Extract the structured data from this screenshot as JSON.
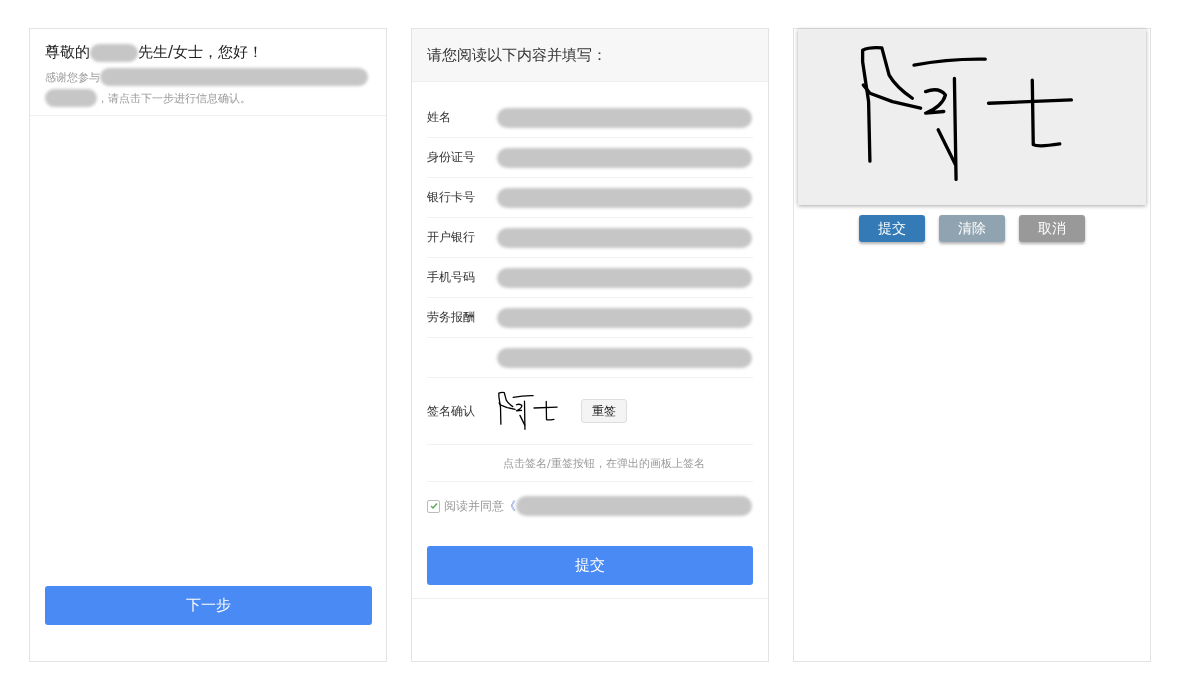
{
  "greeting_panel": {
    "greeting_start": "尊敬的",
    "greeting_end": "先生/女士，您好！",
    "intro_start": "感谢您参与",
    "intro_end": "，请点击下一步进行信息确认。",
    "next_button": "下一步"
  },
  "form_panel": {
    "title": "请您阅读以下内容并填写：",
    "fields": [
      {
        "kind": "labeled",
        "label": "姓名"
      },
      {
        "kind": "labeled",
        "label": "身份证号"
      },
      {
        "kind": "labeled",
        "label": "银行卡号"
      },
      {
        "kind": "labeled",
        "label": "开户银行"
      },
      {
        "kind": "labeled",
        "label": "手机号码"
      },
      {
        "kind": "labeled",
        "label": "劳务报酬"
      },
      {
        "kind": "unlabeled"
      }
    ],
    "signature_label": "签名确认",
    "resign_button": "重签",
    "hint": "点击签名/重签按钮，在弹出的画板上签名",
    "agree": {
      "checked": true,
      "text": "阅读并同意",
      "quote": "《"
    },
    "submit_button": "提交"
  },
  "signature_pad": {
    "buttons": [
      {
        "label": "提交",
        "kind": "primary"
      },
      {
        "label": "清除",
        "kind": "secondary"
      },
      {
        "label": "取消",
        "kind": "muted"
      }
    ]
  }
}
